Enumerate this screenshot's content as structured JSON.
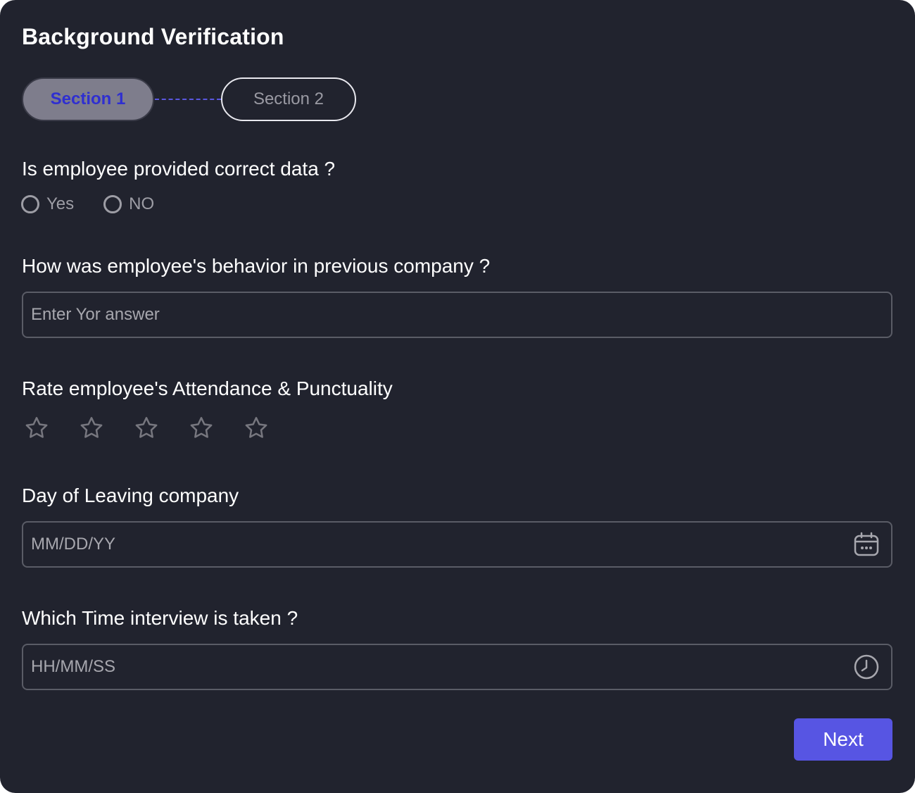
{
  "header": {
    "title": "Background Verification"
  },
  "stepper": {
    "steps": [
      {
        "label": "Section 1",
        "state": "active"
      },
      {
        "label": "Section 2",
        "state": "inactive"
      }
    ]
  },
  "questions": {
    "correct_data": {
      "label": "Is employee provided correct data ?",
      "options": [
        "Yes",
        "NO"
      ],
      "selected": null
    },
    "behavior": {
      "label": "How was employee's behavior in previous company ?",
      "placeholder": "Enter Yor answer",
      "value": ""
    },
    "attendance": {
      "label": "Rate employee's Attendance & Punctuality",
      "rating": 0,
      "max_rating": 5
    },
    "leaving_day": {
      "label": "Day of Leaving company",
      "placeholder": "MM/DD/YY",
      "value": "",
      "icon": "calendar-icon"
    },
    "interview_time": {
      "label": "Which Time interview is taken ?",
      "placeholder": "HH/MM/SS",
      "value": "",
      "icon": "clock-icon"
    }
  },
  "actions": {
    "next_label": "Next"
  },
  "colors": {
    "background": "#21232e",
    "accent": "#5755e3",
    "active_step_bg": "#7e7d8c",
    "active_step_text": "#2f2fd0",
    "muted_text": "#9d9da5"
  }
}
